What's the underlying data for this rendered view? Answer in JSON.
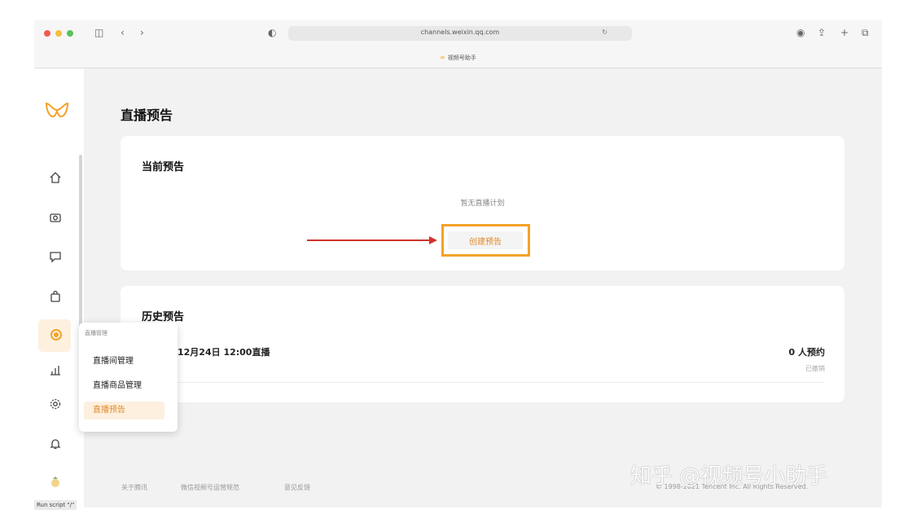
{
  "browser": {
    "url": "channels.weixin.qq.com",
    "tab_title": "视频号助手"
  },
  "page": {
    "title": "直播预告",
    "current_section": {
      "title": "当前预告",
      "empty_text": "暂无直播计划",
      "create_button": "创建预告"
    },
    "history_section": {
      "title": "历史预告",
      "items": [
        {
          "date_text": "12月24日 12:00直播",
          "count_text": "0 人预约",
          "status": "已撤销"
        }
      ]
    }
  },
  "popover": {
    "title": "直播管理",
    "items": [
      {
        "label": "直播间管理",
        "active": false
      },
      {
        "label": "直播商品管理",
        "active": false
      },
      {
        "label": "直播预告",
        "active": true
      }
    ]
  },
  "sidebar": {
    "icons": [
      "home-icon",
      "camera-icon",
      "comment-icon",
      "bag-icon",
      "live-icon",
      "chart-icon",
      "settings-icon",
      "bell-icon",
      "avatar"
    ]
  },
  "footer": {
    "links": [
      "关于腾讯",
      "微信视频号运营规范",
      "意见反馈"
    ],
    "copyright": "© 1998-2021 Tencent Inc. All Rights Reserved."
  },
  "watermark": "知乎 @视频号小助手",
  "status_bar": "Run script \"/\"",
  "colors": {
    "accent": "#f3a229",
    "arrow": "#d0342c"
  }
}
